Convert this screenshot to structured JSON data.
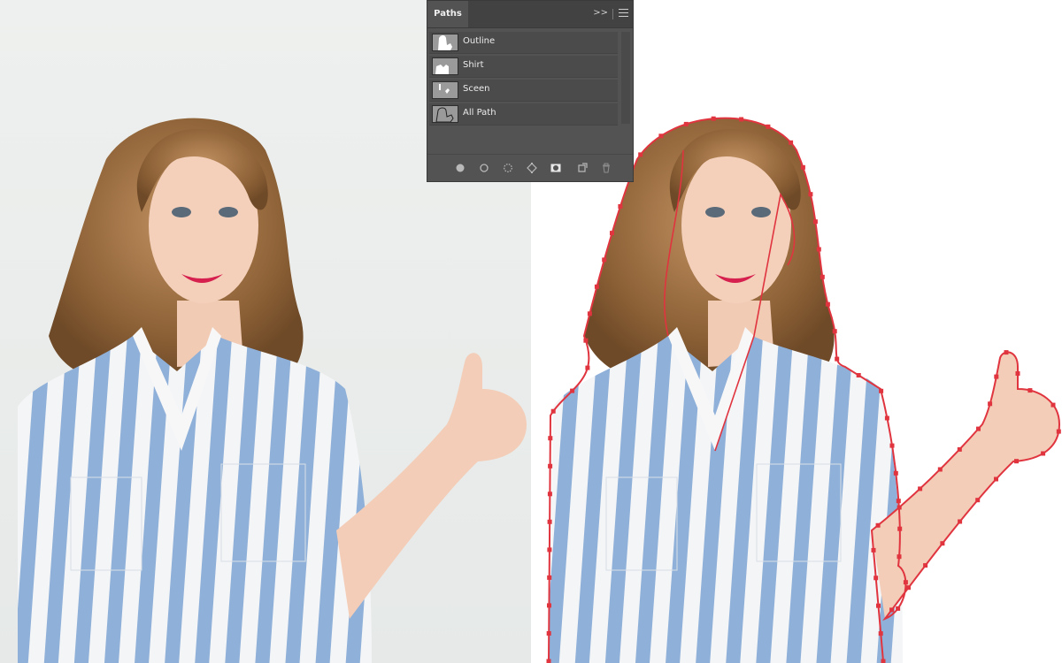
{
  "panel": {
    "tab_label": "Paths",
    "collapse_glyph": ">>",
    "paths": [
      {
        "label": "Outline"
      },
      {
        "label": "Shirt"
      },
      {
        "label": "Sceen"
      },
      {
        "label": "All Path"
      }
    ],
    "footer_tools": [
      "fill-path-icon",
      "stroke-path-icon",
      "load-as-selection-icon",
      "make-work-path-icon",
      "add-mask-icon",
      "new-path-icon",
      "delete-path-icon"
    ]
  },
  "colors": {
    "panel_bg": "#535353",
    "path_outline": "#e0343f",
    "shirt_stripe": "#8fb0d8",
    "hair": "#9b6e3f"
  }
}
